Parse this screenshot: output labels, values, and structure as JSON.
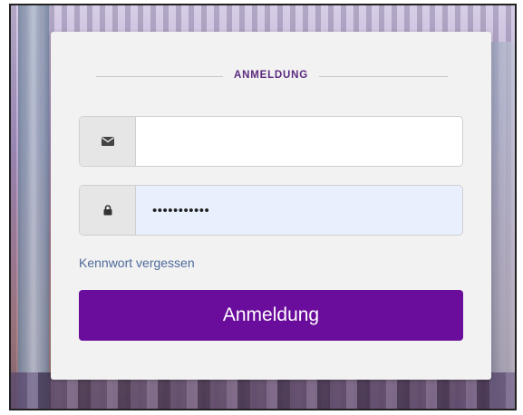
{
  "login": {
    "title": "ANMELDUNG",
    "email": {
      "icon": "envelope-icon",
      "value": "",
      "placeholder": ""
    },
    "password": {
      "icon": "lock-icon",
      "value": "•••••••••••"
    },
    "forgot_password_label": "Kennwort vergessen",
    "submit_label": "Anmeldung"
  },
  "colors": {
    "accent": "#6a0c9c",
    "title": "#5b2a7e",
    "link": "#4e6a9a",
    "card": "#f2f2f2"
  }
}
